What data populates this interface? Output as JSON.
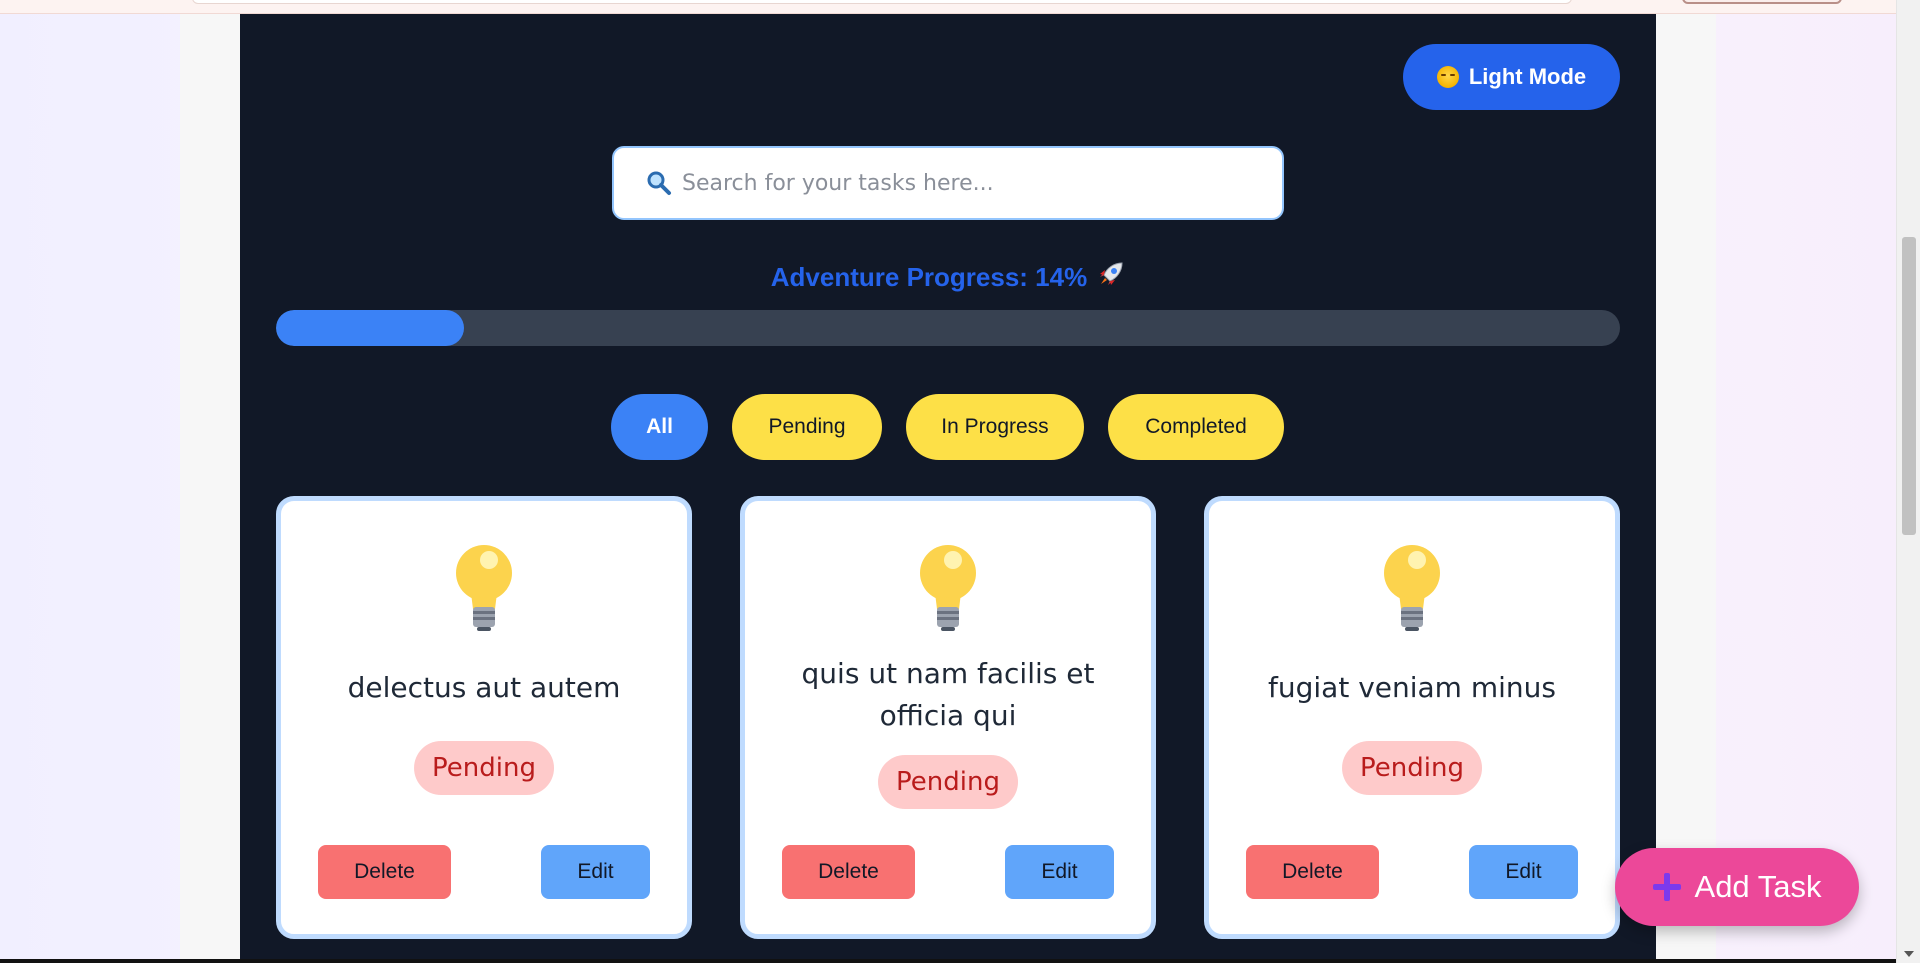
{
  "header": {
    "theme_toggle_label": "Light Mode"
  },
  "search": {
    "placeholder": "Search for your tasks here...",
    "value": ""
  },
  "progress": {
    "label": "Adventure Progress: 14%",
    "percent": 14
  },
  "filters": [
    {
      "label": "All",
      "active": true
    },
    {
      "label": "Pending",
      "active": false
    },
    {
      "label": "In Progress",
      "active": false
    },
    {
      "label": "Completed",
      "active": false
    }
  ],
  "tasks": [
    {
      "title": "delectus aut autem",
      "status": "Pending",
      "delete_label": "Delete",
      "edit_label": "Edit"
    },
    {
      "title": "quis ut nam facilis et officia qui",
      "status": "Pending",
      "delete_label": "Delete",
      "edit_label": "Edit"
    },
    {
      "title": "fugiat veniam minus",
      "status": "Pending",
      "delete_label": "Delete",
      "edit_label": "Edit"
    }
  ],
  "add_task": {
    "label": "Add Task"
  },
  "colors": {
    "app_background": "#111827",
    "accent_blue": "#2563eb",
    "filter_yellow": "#fde047",
    "status_pending_bg": "#fecaca",
    "status_pending_text": "#b91c1c",
    "add_task_pink": "#ec4899"
  },
  "icons": [
    "sun-face-icon",
    "search-icon",
    "rocket-icon",
    "lightbulb-icon",
    "plus-icon"
  ]
}
